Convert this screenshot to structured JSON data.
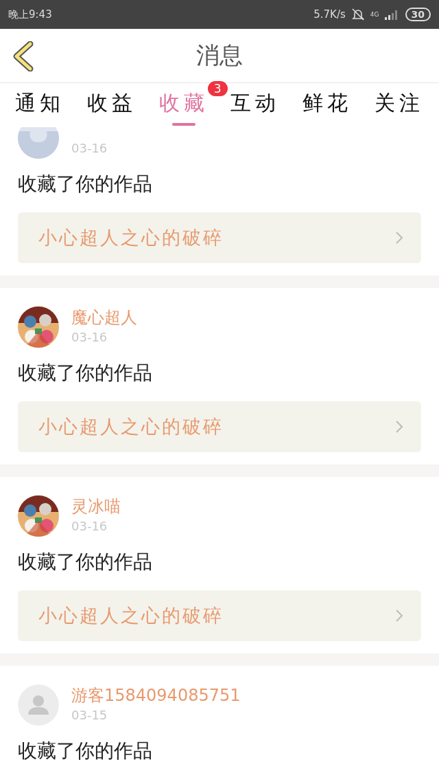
{
  "status_bar": {
    "time": "晚上9:43",
    "speed": "5.7K/s",
    "network": "4G",
    "battery": "30"
  },
  "header": {
    "title": "消息"
  },
  "tabs": [
    {
      "label": "通知",
      "selected": false
    },
    {
      "label": "收益",
      "selected": false
    },
    {
      "label": "收藏",
      "selected": true,
      "badge": "3"
    },
    {
      "label": "互动",
      "selected": false
    },
    {
      "label": "鲜花",
      "selected": false
    },
    {
      "label": "关注",
      "selected": false
    }
  ],
  "items": [
    {
      "avatar": {
        "kind": "default"
      },
      "date": "03-16",
      "action": "收藏了你的作品",
      "work": "小心超人之心的破碎",
      "kind": "cut"
    },
    {
      "name": "魔心超人",
      "date": "03-16",
      "action": "收藏了你的作品",
      "work": "小心超人之心的破碎",
      "kind": "full"
    },
    {
      "name": "灵冰喵",
      "date": "03-16",
      "action": "收藏了你的作品",
      "work": "小心超人之心的破碎",
      "kind": "full"
    },
    {
      "avatar": {
        "kind": "guest"
      },
      "name": "游客1584094085751",
      "date": "03-15",
      "action": "收藏了你的作品",
      "kind": "full"
    }
  ]
}
